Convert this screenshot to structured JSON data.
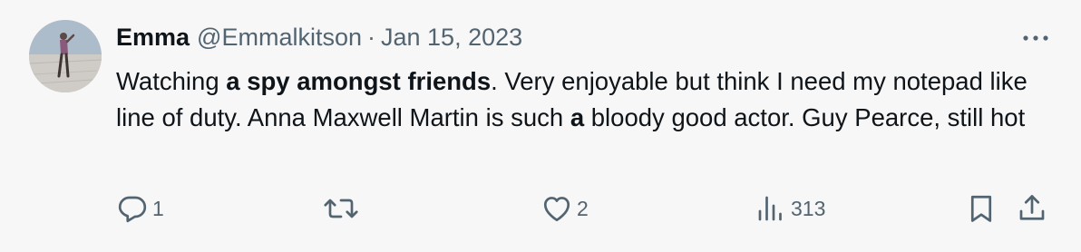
{
  "tweet": {
    "author": {
      "name": "Emma",
      "handle": "@Emmalkitson"
    },
    "separator": "·",
    "date": "Jan 15, 2023",
    "body": {
      "p1": "Watching ",
      "b1": "a spy amongst friends",
      "p2": ". Very enjoyable but think I need my notepad like line of duty. Anna Maxwell Martin is such ",
      "b2": "a",
      "p3": " bloody good actor. Guy Pearce, still hot"
    },
    "actions": {
      "reply_count": "1",
      "retweet_count": "",
      "like_count": "2",
      "view_count": "313"
    },
    "icons": {
      "more": "more-options-icon",
      "reply": "reply-icon",
      "retweet": "retweet-icon",
      "like": "heart-icon",
      "views": "analytics-icon",
      "bookmark": "bookmark-icon",
      "share": "share-icon"
    },
    "colors": {
      "text_primary": "#0f1419",
      "text_secondary": "#536471",
      "background": "#f7f7f7"
    }
  }
}
